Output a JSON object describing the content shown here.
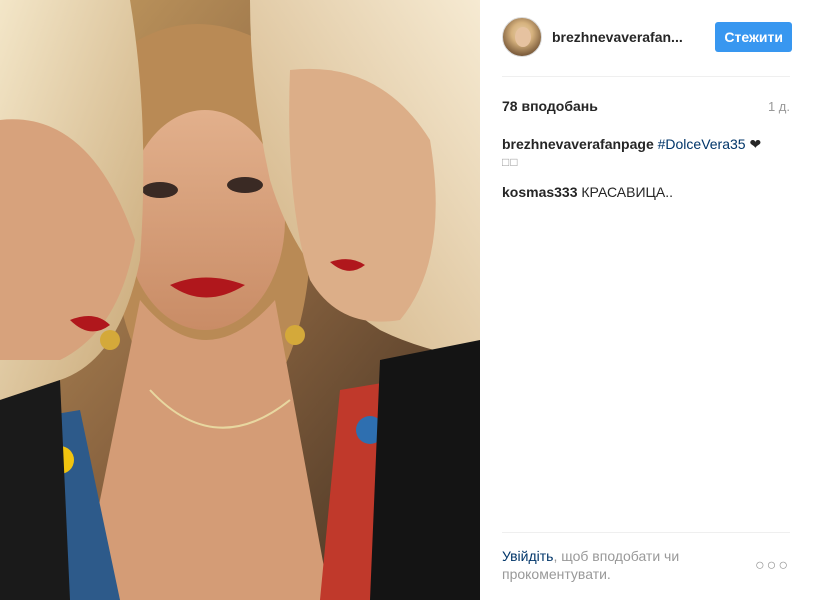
{
  "post": {
    "photo_label": "post-photo",
    "author": {
      "username": "brezhnevaverafanpage",
      "username_display": "brezhnevaverafan..."
    },
    "follow_label": "Стежити",
    "likes": "78 вподобань",
    "timestamp": "1 д.",
    "caption": {
      "author": "brezhnevaverafanpage",
      "hashtag": "#DolceVera35",
      "emoji": "❤",
      "boxes": "□□"
    },
    "comments": [
      {
        "author": "kosmas333",
        "text": "КРАСАВИЦА.."
      }
    ],
    "login_prompt": {
      "link": "Увійдіть",
      "text": ", щоб вподобати чи прокоментувати."
    },
    "more_label": "○○○"
  },
  "colors": {
    "follow_button": "#3897f0",
    "link": "#003569",
    "muted": "#999999"
  }
}
